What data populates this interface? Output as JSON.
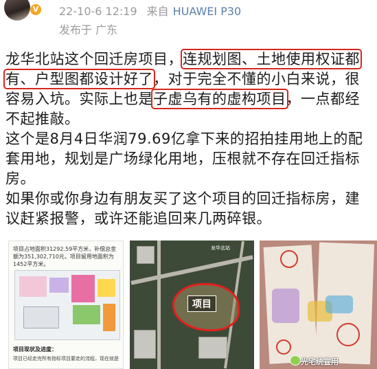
{
  "header": {
    "timestamp": "22-10-6 12:19",
    "source_prefix": "来自",
    "device": "HUAWEI P30",
    "published": "发布于 广东"
  },
  "post": {
    "p1_a": "龙华北站这个回迁房项目，",
    "p1_hl1": "连规划图、土地使用权证都有、户型图都设计好了",
    "p1_b": "，对于完全不懂的小白来说，很容易入坑。实际上也是",
    "p1_hl2": "子虚乌有的虚构项目",
    "p1_c": "，一点都经不起推敲。",
    "p2": "这个是8月4日华润79.69亿拿下来的招拍挂用地上的配套用地，规划是广场绿化用地，压根就不存在回迁指标房。",
    "p3": "如果你或你身边有朋友买了这个项目的回迁指标房，建议赶紧报警，或许还能追回来几两碎银。"
  },
  "images": {
    "doc_text": "项目占地面积31292.59平方米，补偿总金额为351,302,710元，项目留用地面积为1452平方米。",
    "doc_title": "项目现状及进度：",
    "doc_line": "项目已经走完所有指标项目要走的流程，现在就是",
    "sat_label": "项目",
    "sat_small_1": "龙华北站",
    "watermark": "光宅统宣用"
  },
  "colors": {
    "highlight": "#d6261c",
    "device_link": "#5a7fa8",
    "meta": "#9a9a9a"
  }
}
